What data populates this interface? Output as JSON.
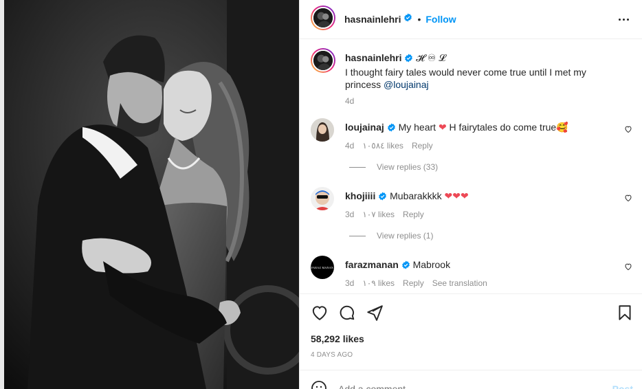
{
  "header": {
    "username": "hasnainlehri",
    "dot": "•",
    "follow_label": "Follow"
  },
  "caption": {
    "username": "hasnainlehri",
    "emojis": "𝓗 ♾ 𝓛",
    "text_line1": "I thought fairy tales would never come true until I met my",
    "text_line2_prefix": "princess ",
    "mention": "@loujainaj",
    "time": "4d"
  },
  "comments": [
    {
      "username": "loujainaj",
      "text": "My heart ❤ H fairytales do come true🥰",
      "time": "4d",
      "likes": "١٠٥٨٤ likes",
      "reply": "Reply",
      "view_replies": "View replies (33)"
    },
    {
      "username": "khojiiii",
      "text": "Mubarakkkk ❤❤❤",
      "time": "3d",
      "likes": "١٠٧ likes",
      "reply": "Reply",
      "view_replies": "View replies (1)"
    },
    {
      "username": "farazmanan",
      "text": "Mabrook",
      "time": "3d",
      "likes": "١٠٩ likes",
      "reply": "Reply",
      "see_translation": "See translation",
      "avatar_text": "FARAZ MANAN"
    }
  ],
  "post": {
    "likes": "58,292 likes",
    "date": "4 DAYS AGO"
  },
  "add_comment": {
    "placeholder": "Add a comment...",
    "post_label": "Post"
  },
  "icons": {
    "verified": "verified-badge-icon",
    "more": "more-options-icon",
    "like": "heart-icon",
    "comment": "comment-bubble-icon",
    "share": "paper-plane-icon",
    "save": "bookmark-icon",
    "emoji": "emoji-icon"
  },
  "colors": {
    "accent": "#0095f6",
    "heart_red": "#ed4956",
    "muted": "#8e8e8e"
  }
}
